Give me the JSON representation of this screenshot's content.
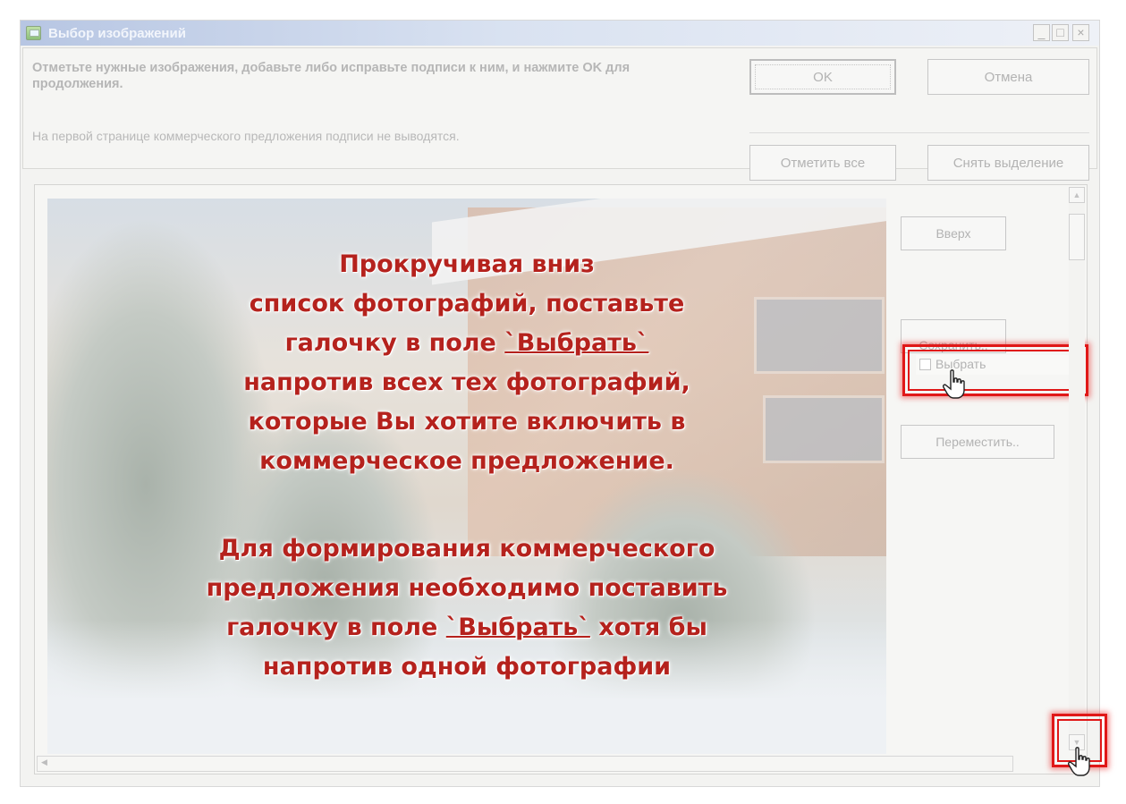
{
  "window": {
    "title": "Выбор изображений",
    "minimize": "_",
    "maximize": "□",
    "close": "×"
  },
  "header": {
    "instruction": "Отметьте нужные изображения, добавьте либо исправьте подписи к ним, и нажмите OK для продолжения.",
    "note": "На первой странице коммерческого предложения подписи не выводятся.",
    "ok_label": "OK",
    "cancel_label": "Отмена",
    "select_all_label": "Отметить все",
    "clear_selection_label": "Снять выделение"
  },
  "item": {
    "up_label": "Вверх",
    "save_label": "Сохранить..",
    "select_label": "Выбрать",
    "select_checked": false,
    "move_label": "Переместить.."
  },
  "overlay": {
    "block1_line1": "Прокручивая вниз",
    "block1_line2": "список фотографий, поставьте",
    "block1_line3_pre": "галочку в поле ",
    "block1_line3_field": "`Выбрать`",
    "block1_line4": "напротив всех тех фотографий,",
    "block1_line5": "которые Вы хотите включить в",
    "block1_line6": "коммерческое предложение.",
    "block2_line1": "Для формирования коммерческого",
    "block2_line2": "предложения необходимо поставить",
    "block2_line3_pre": "галочку в поле ",
    "block2_line3_field": "`Выбрать`",
    "block2_line3_post": " хотя бы",
    "block2_line4": "напротив одной фотографии"
  },
  "icons": {
    "app": "image-gallery-icon",
    "pointer": "hand-pointer-icon",
    "scroll_up": "scroll-up-arrow-icon",
    "scroll_down": "scroll-down-arrow-icon",
    "scroll_left": "scroll-left-arrow-icon"
  },
  "colors": {
    "highlight": "#e01818",
    "overlay_text": "#b5221d"
  }
}
